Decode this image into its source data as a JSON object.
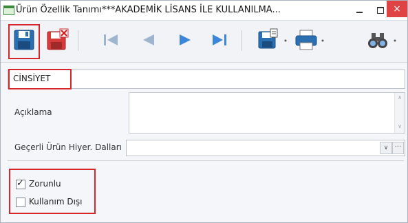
{
  "window": {
    "title": "Ürün Özellik Tanımı***AKADEMİK LİSANS İLE KULLANILMA...",
    "close_glyph": "×"
  },
  "toolbar": {
    "tools": [
      {
        "name": "save-icon",
        "color": "#2b6fb3"
      },
      {
        "name": "delete-icon",
        "color": "#d63a3a"
      },
      {
        "name": "first-record-icon",
        "color": "#9fb4cf"
      },
      {
        "name": "previous-record-icon",
        "color": "#9fb4cf"
      },
      {
        "name": "next-record-icon",
        "color": "#3b86d9"
      },
      {
        "name": "last-record-icon",
        "color": "#3b86d9"
      },
      {
        "name": "export-icon",
        "color": "#2b6fb3"
      },
      {
        "name": "print-icon",
        "color": "#2b6fb3"
      },
      {
        "name": "binoculars-icon",
        "color": "#2b6fb3"
      }
    ]
  },
  "form": {
    "name_value": "CİNSİYET",
    "description_label": "Açıklama",
    "description_value": "",
    "hierarchy_label": "Geçerli Ürün Hiyer. Dalları",
    "hierarchy_value": "",
    "ellipsis": "···"
  },
  "options": {
    "required_label": "Zorunlu",
    "required_checked": true,
    "disabled_label": "Kullanım Dışı",
    "disabled_checked": false
  },
  "colors": {
    "highlight": "#d6262b",
    "close": "#e04343"
  }
}
